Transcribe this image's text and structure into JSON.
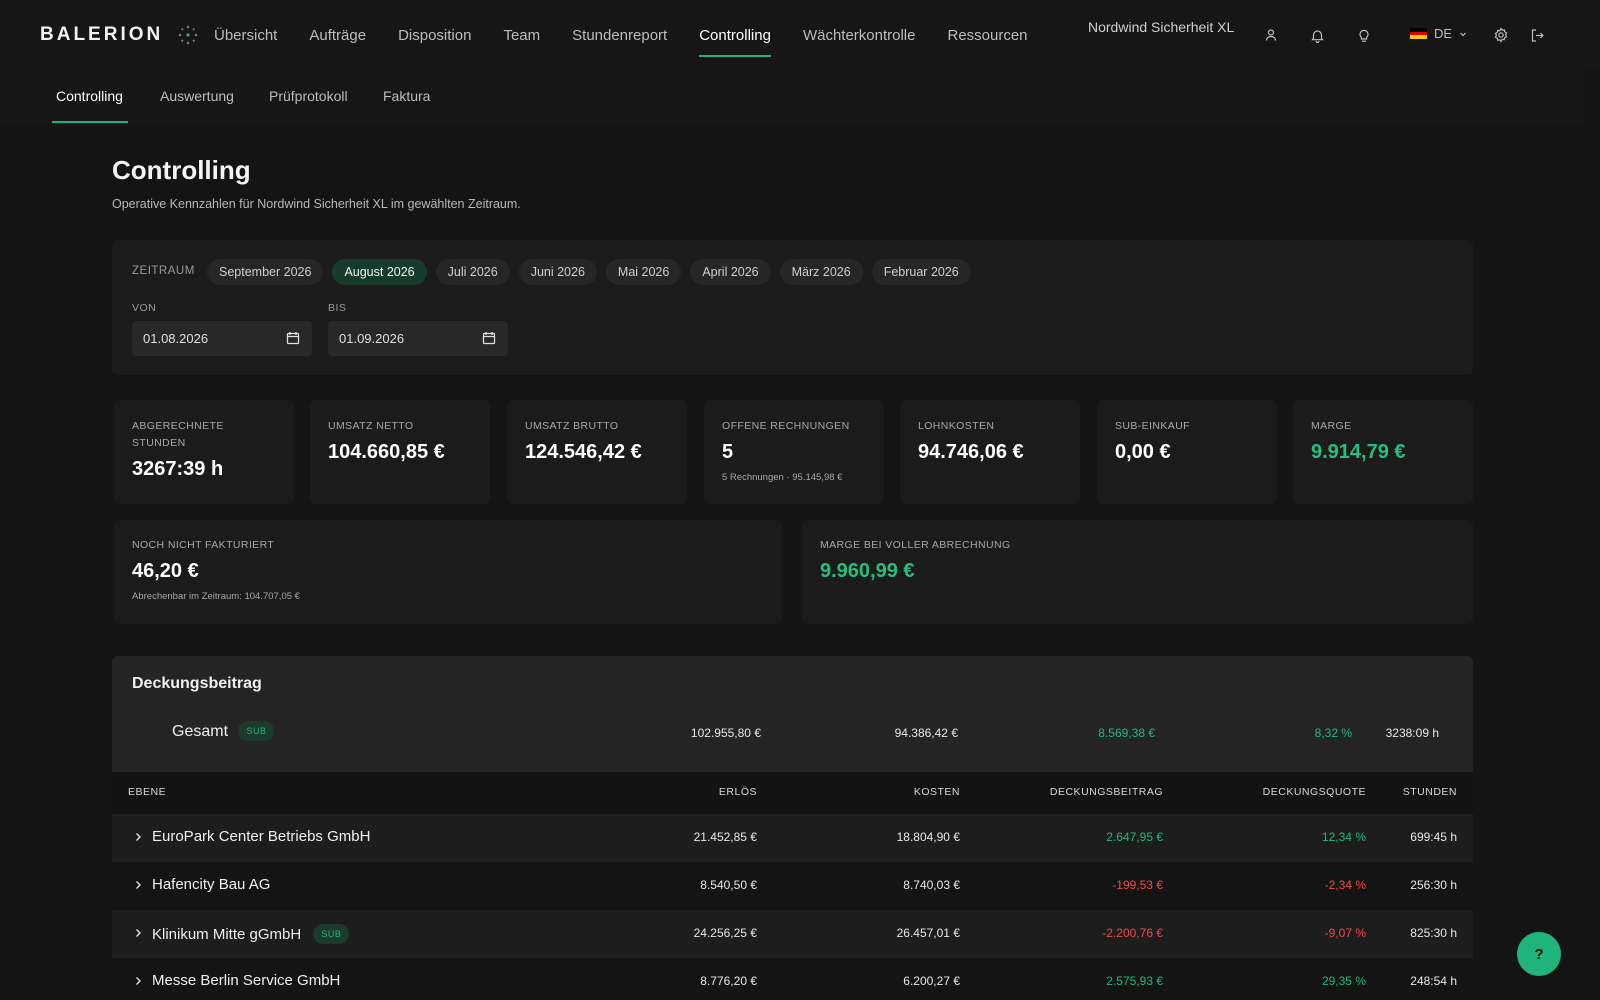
{
  "brand": {
    "name": "BALERION"
  },
  "nav": {
    "items": [
      {
        "label": "Übersicht"
      },
      {
        "label": "Aufträge"
      },
      {
        "label": "Disposition"
      },
      {
        "label": "Team"
      },
      {
        "label": "Stundenreport"
      },
      {
        "label": "Controlling"
      },
      {
        "label": "Wächterkontrolle"
      },
      {
        "label": "Ressourcen"
      }
    ],
    "active": "Controlling",
    "org_name": "Nordwind Sicherheit XL",
    "language": "DE",
    "icons": [
      "user-icon",
      "bell-icon",
      "lightbulb-icon",
      "settings-icon",
      "logout-icon"
    ]
  },
  "subnav": {
    "items": [
      {
        "label": "Controlling"
      },
      {
        "label": "Auswertung"
      },
      {
        "label": "Prüfprotokoll"
      },
      {
        "label": "Faktura"
      }
    ],
    "active": "Controlling"
  },
  "page": {
    "title": "Controlling",
    "subtitle": "Operative Kennzahlen für Nordwind Sicherheit XL im gewählten Zeitraum."
  },
  "filter": {
    "label": "ZEITRAUM",
    "periods": [
      {
        "label": "September 2026"
      },
      {
        "label": "August 2026"
      },
      {
        "label": "Juli 2026"
      },
      {
        "label": "Juni 2026"
      },
      {
        "label": "Mai 2026"
      },
      {
        "label": "April 2026"
      },
      {
        "label": "März 2026"
      },
      {
        "label": "Februar 2026"
      }
    ],
    "active_period": "August 2026",
    "from_label": "VON",
    "from_value": "01.08.2026",
    "to_label": "BIS",
    "to_value": "01.09.2026"
  },
  "kpis": [
    {
      "label": "ABGERECHNETE STUNDEN",
      "value": "3267:39 h",
      "hint": ""
    },
    {
      "label": "UMSATZ NETTO",
      "value": "104.660,85 €",
      "hint": ""
    },
    {
      "label": "UMSATZ BRUTTO",
      "value": "124.546,42 €",
      "hint": ""
    },
    {
      "label": "OFFENE RECHNUNGEN",
      "value": "5",
      "hint": "5 Rechnungen · 95.145,98 €"
    },
    {
      "label": "LOHNKOSTEN",
      "value": "94.746,06 €",
      "hint": ""
    },
    {
      "label": "SUB-EINKAUF",
      "value": "0,00 €",
      "hint": ""
    },
    {
      "label": "MARGE",
      "value": "9.914,79 €",
      "hint": ""
    }
  ],
  "wide": {
    "unbilled": {
      "label": "NOCH NICHT FAKTURIERT",
      "value": "46,20 €",
      "hint": "Abrechenbar im Zeitraum: 104.707,05 €"
    },
    "full_margin": {
      "label": "MARGE BEI VOLLER ABRECHNUNG",
      "value": "9.960,99 €"
    }
  },
  "db": {
    "title": "Deckungsbeitrag",
    "total": {
      "label": "Gesamt",
      "badge": "SUB",
      "erloes": "102.955,80 €",
      "kosten": "94.386,42 €",
      "deckungsbeitrag": "8.569,38 €",
      "quote": "8,32 %",
      "stunden": "3238:09 h"
    },
    "columns": {
      "ebene": "EBENE",
      "erloes": "ERLÖS",
      "kosten": "KOSTEN",
      "deckungsbeitrag": "DECKUNGSBEITRAG",
      "quote": "DECKUNGSQUOTE",
      "stunden": "STUNDEN"
    },
    "rows": [
      {
        "name": "EuroPark Center Betriebs GmbH",
        "badge": "",
        "erloes": "21.452,85 €",
        "kosten": "18.804,90 €",
        "deckungsbeitrag": "2.647,95 €",
        "quote": "12,34 %",
        "stunden": "699:45 h",
        "status": "positive"
      },
      {
        "name": "Hafencity Bau AG",
        "badge": "",
        "erloes": "8.540,50 €",
        "kosten": "8.740,03 €",
        "deckungsbeitrag": "-199,53 €",
        "quote": "-2,34 %",
        "stunden": "256:30 h",
        "status": "negative"
      },
      {
        "name": "Klinikum Mitte gGmbH",
        "badge": "SUB",
        "erloes": "24.256,25 €",
        "kosten": "26.457,01 €",
        "deckungsbeitrag": "-2.200,76 €",
        "quote": "-9,07 %",
        "stunden": "825:30 h",
        "status": "negative"
      },
      {
        "name": "Messe Berlin Service GmbH",
        "badge": "",
        "erloes": "8.776,20 €",
        "kosten": "6.200,27 €",
        "deckungsbeitrag": "2.575,93 €",
        "quote": "29,35 %",
        "stunden": "248:54 h",
        "status": "positive"
      }
    ]
  },
  "help": {
    "label": "?"
  },
  "colors": {
    "accent": "#1fb57a",
    "positive": "#22b97a",
    "negative": "#ef4a4a",
    "background": "#141414"
  }
}
